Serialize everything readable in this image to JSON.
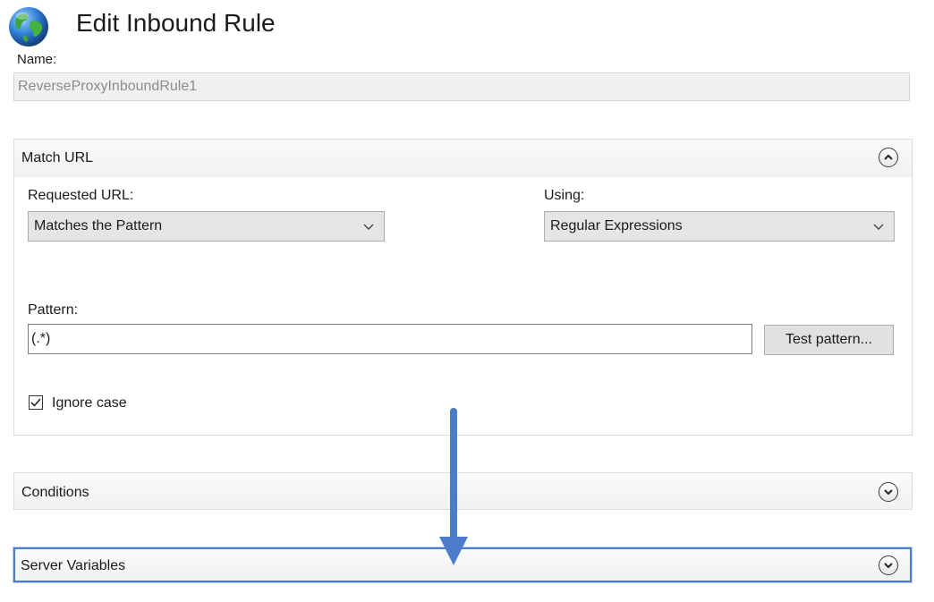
{
  "header": {
    "title": "Edit Inbound Rule",
    "icon": "globe-icon"
  },
  "name_field": {
    "label": "Name:",
    "value": "ReverseProxyInboundRule1"
  },
  "match_url": {
    "title": "Match URL",
    "requested_url_label": "Requested URL:",
    "requested_url_value": "Matches the Pattern",
    "using_label": "Using:",
    "using_value": "Regular Expressions",
    "pattern_label": "Pattern:",
    "pattern_value": "(.*)",
    "test_button": "Test pattern...",
    "ignore_case_label": "Ignore case",
    "ignore_case_checked": true
  },
  "conditions": {
    "title": "Conditions"
  },
  "server_variables": {
    "title": "Server Variables"
  },
  "colors": {
    "arrow": "#4a7cc9",
    "focus_border": "#4a7cc9"
  }
}
